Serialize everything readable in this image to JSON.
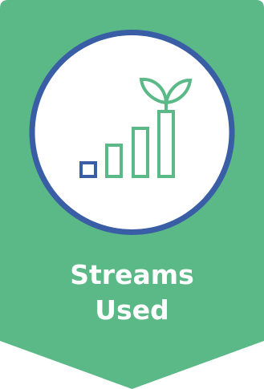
{
  "badge": {
    "title_line_1": "Streams",
    "title_line_2": "Used",
    "icon": "growth-bar-chart-with-sprout-icon",
    "colors": {
      "banner": "#5BB988",
      "circle_fill": "#ffffff",
      "circle_ring": "#3A5EA6",
      "icon_stroke": "#5BB988",
      "smallest_bar": "#3A5EA6",
      "text": "#ffffff"
    }
  }
}
